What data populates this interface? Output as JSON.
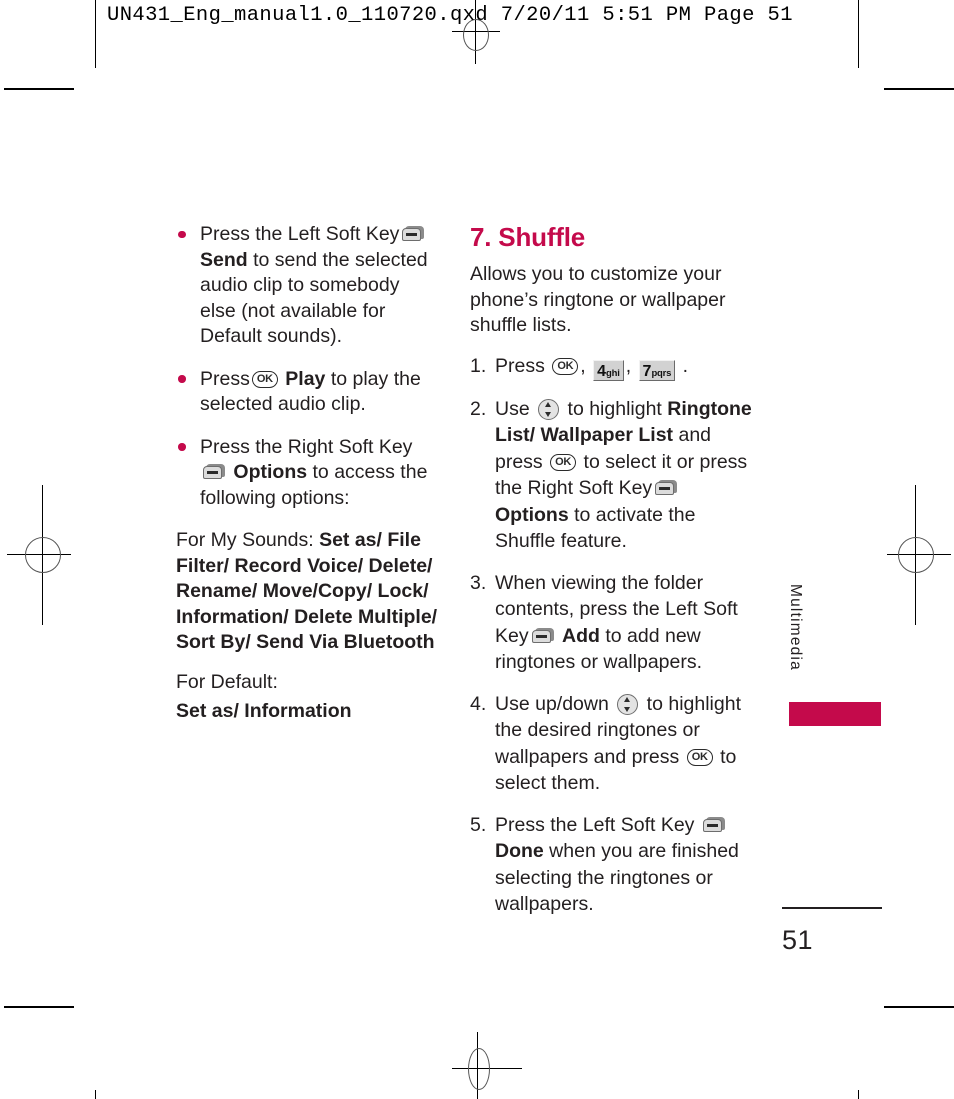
{
  "header": {
    "slug": "UN431_Eng_manual1.0_110720.qxd   7/20/11   5:51 PM   Page 51"
  },
  "colors": {
    "accent": "#C40A4B",
    "text": "#231F20",
    "key_face": "#DCDCDC"
  },
  "left_column": {
    "bullets": [
      {
        "before": "Press the Left Soft Key",
        "icon": "left-soft-key-icon",
        "bold": "Send",
        "after": "to send the selected audio clip to somebody else (not available for Default sounds)."
      },
      {
        "before": "Press",
        "icon": "ok-key-icon",
        "bold": "Play",
        "after": "to play the selected audio clip."
      },
      {
        "before": "Press the Right Soft Key",
        "icon": "right-soft-key-icon",
        "bold": "Options",
        "after": "to access the following options:"
      }
    ],
    "my_sounds_label": "For My Sounds:",
    "my_sounds_options": "Set as/ File Filter/ Record Voice/ Delete/ Rename/ Move/Copy/ Lock/ Information/ Delete Multiple/ Sort By/ Send Via Bluetooth",
    "default_label": "For Default:",
    "default_options": "Set as/ Information"
  },
  "right_column": {
    "heading": "7. Shuffle",
    "intro": "Allows you to customize your phone’s ringtone or wallpaper shuffle lists.",
    "steps": [
      {
        "num": "1.",
        "t1": "Press",
        "key_ok": "OK",
        "sep1": ",",
        "key_4_num": "4",
        "key_4_letters": "ghi",
        "sep2": ",",
        "key_7_num": "7",
        "key_7_letters": "pqrs",
        "end": "."
      },
      {
        "num": "2.",
        "t1": "Use",
        "nav_icon": "nav-updown-key-icon",
        "t2": "to highlight",
        "bold1": "Ringtone List/ Wallpaper List",
        "t3": "and press",
        "key_ok": "OK",
        "t4": "to select it or press the Right Soft Key",
        "soft_icon": "right-soft-key-icon",
        "bold2": "Options",
        "t5": "to activate the Shuffle feature."
      },
      {
        "num": "3.",
        "t1": "When viewing the folder contents, press the Left Soft Key",
        "soft_icon": "left-soft-key-icon",
        "bold1": "Add",
        "t2": "to add new ringtones or wallpapers."
      },
      {
        "num": "4.",
        "t1": "Use up/down",
        "nav_icon": "nav-updown-key-icon",
        "t2": "to highlight the desired ringtones or wallpapers and press",
        "key_ok": "OK",
        "t3": "to select them."
      },
      {
        "num": "5.",
        "t1": "Press the Left Soft Key",
        "soft_icon": "left-soft-key-icon",
        "bold1": "Done",
        "t2": "when you are finished selecting the ringtones or wallpapers."
      }
    ]
  },
  "chapter_tab": {
    "label": "Multimedia"
  },
  "footer": {
    "page_number": "51"
  }
}
